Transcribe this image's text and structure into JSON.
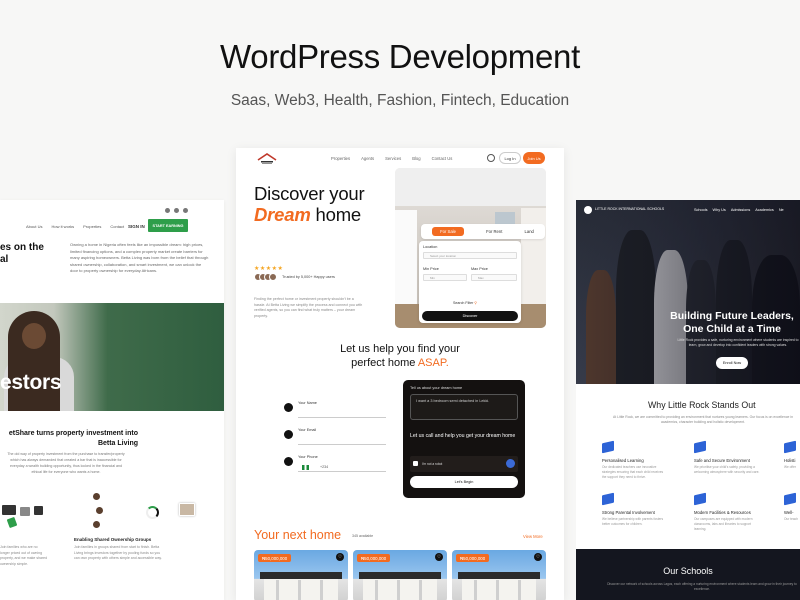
{
  "header": {
    "title": "WordPress Development",
    "subtitle": "Saas, Web3, Health, Fashion, Fintech, Education"
  },
  "left_card": {
    "nav_links": [
      "About Us",
      "How it works",
      "Properties",
      "Contact"
    ],
    "sign_in": "SIGN IN",
    "cta": "START EARNING",
    "hero_heading_lines": [
      "es on the",
      "al"
    ],
    "hero_paragraph": "Owning a home in Nigeria often feels like an impossible dream: high prices, limited financing options, and a complex property market create barriers for many aspiring homeowners. Betta Living was born from the belief that through shared ownership, collaboration, and smart investment, we can unlock the door to property ownership for everyday Africans.",
    "image_text": "estors",
    "section_title": "etShare turns property investment into Betta Living",
    "section_body": "The old way of property investment from the purchase to transfer/property which has always demanded that created a bar that is inaccessible for everyday a wealth building opportunity, thus locked in the financial and ethical life for everyone who wants a home.",
    "group_title": "Enabling Shared Ownership Groups",
    "group_body": "Join families in groups shared from start to finish. Betta Living brings investors together by pooling funds so you can own property with others simple and accessible way.",
    "left_body": "Join families who are no longer priced out of owning property, and we make shared ownership simple."
  },
  "center_card": {
    "nav": [
      "Properties",
      "Agents",
      "Services",
      "Blog",
      "Contact Us"
    ],
    "login": "Log In",
    "join": "Join Us",
    "hero_line1": "Discover your",
    "hero_dream": "Dream",
    "hero_line2_rest": " home",
    "stars": "★★★★★",
    "trusted": "Trusted by 5,000+ Happy users",
    "trust_line": "Finding the perfect home",
    "description": "Finding the perfect home or investment property shouldn't be a hassle. At Betta Living we simplify the process and connect you with verified agents, so you can find what truly matters – your dream property.",
    "search_tabs": [
      "For Sale",
      "For Rent",
      "Land"
    ],
    "form": {
      "location_label": "Location",
      "location_placeholder": "Select your location",
      "min_price_label": "Min Price",
      "max_price_label": "Max Price",
      "min_placeholder": "Min",
      "max_placeholder": "Max",
      "advanced": "Search Filter",
      "advanced_icon": "⚲",
      "button": "Discover"
    },
    "help_line1": "Let us help you find your",
    "help_line2": "perfect home ",
    "help_asap": "ASAP.",
    "fields": [
      {
        "label": "Your Name",
        "icon": "user-icon"
      },
      {
        "label": "Your Email",
        "icon": "mail-icon"
      },
      {
        "label": "Your Phone",
        "icon": "phone-icon"
      }
    ],
    "phone_code": "+234",
    "dark_form": {
      "textarea_label": "Tell us about your dream home",
      "textarea_value": "I want a 3 bedroom semi detached in Lekki.",
      "call_text": "Let us call and help you get your dream home",
      "check_text": "I'm not a robot",
      "button": "Let's Begin"
    },
    "listings_title": "Your next home",
    "listings_available": "345 available",
    "view_more": "View More",
    "listings": [
      {
        "price": "₦50,000,000"
      },
      {
        "price": "₦50,000,000"
      },
      {
        "price": "₦50,000,000"
      }
    ],
    "colors": {
      "accent": "#f26b21",
      "dark": "#141110"
    }
  },
  "right_card": {
    "logo_text": "LITTLE ROCK INTERNATIONAL SCHOOLS",
    "nav": [
      "Schools",
      "Why Us",
      "Admissions",
      "Academics",
      "Ne"
    ],
    "hero_title": "Building Future Leaders, One Child at a Time",
    "hero_sub": "Little Rock provides a safe, nurturing environment where students are inspired to learn, grow and develop into confident leaders with strong values.",
    "enroll": "Enroll Now",
    "why_title": "Why Little Rock Stands Out",
    "why_sub": "At Little Rock, we are committed to providing an environment that nurtures young learners. Our focus is on excellence in academics, character building and holistic development.",
    "features": [
      {
        "title": "Personalised Learning",
        "body": "Our dedicated teachers use innovative strategies ensuring that each child receives the support they need to thrive."
      },
      {
        "title": "Safe and Secure Environment",
        "body": "We prioritise your child's safety, providing a welcoming atmosphere with security and care."
      },
      {
        "title": "Holisti",
        "body": "We offer"
      },
      {
        "title": "Strong Parental Involvement",
        "body": "We believe partnership with parents fosters better outcomes for children."
      },
      {
        "title": "Modern Facilities & Resources",
        "body": "Our campuses are equipped with modern classrooms, labs and libraries to support learning."
      },
      {
        "title": "Well-",
        "body": "Our teach"
      }
    ],
    "footer_title": "Our Schools",
    "footer_sub": "Discover our network of schools across Lagos, each offering a nurturing environment where students learn and grow in their journey to excellence.",
    "colors": {
      "feature_icon": "#2d63d6",
      "footer": "#14161f"
    }
  }
}
